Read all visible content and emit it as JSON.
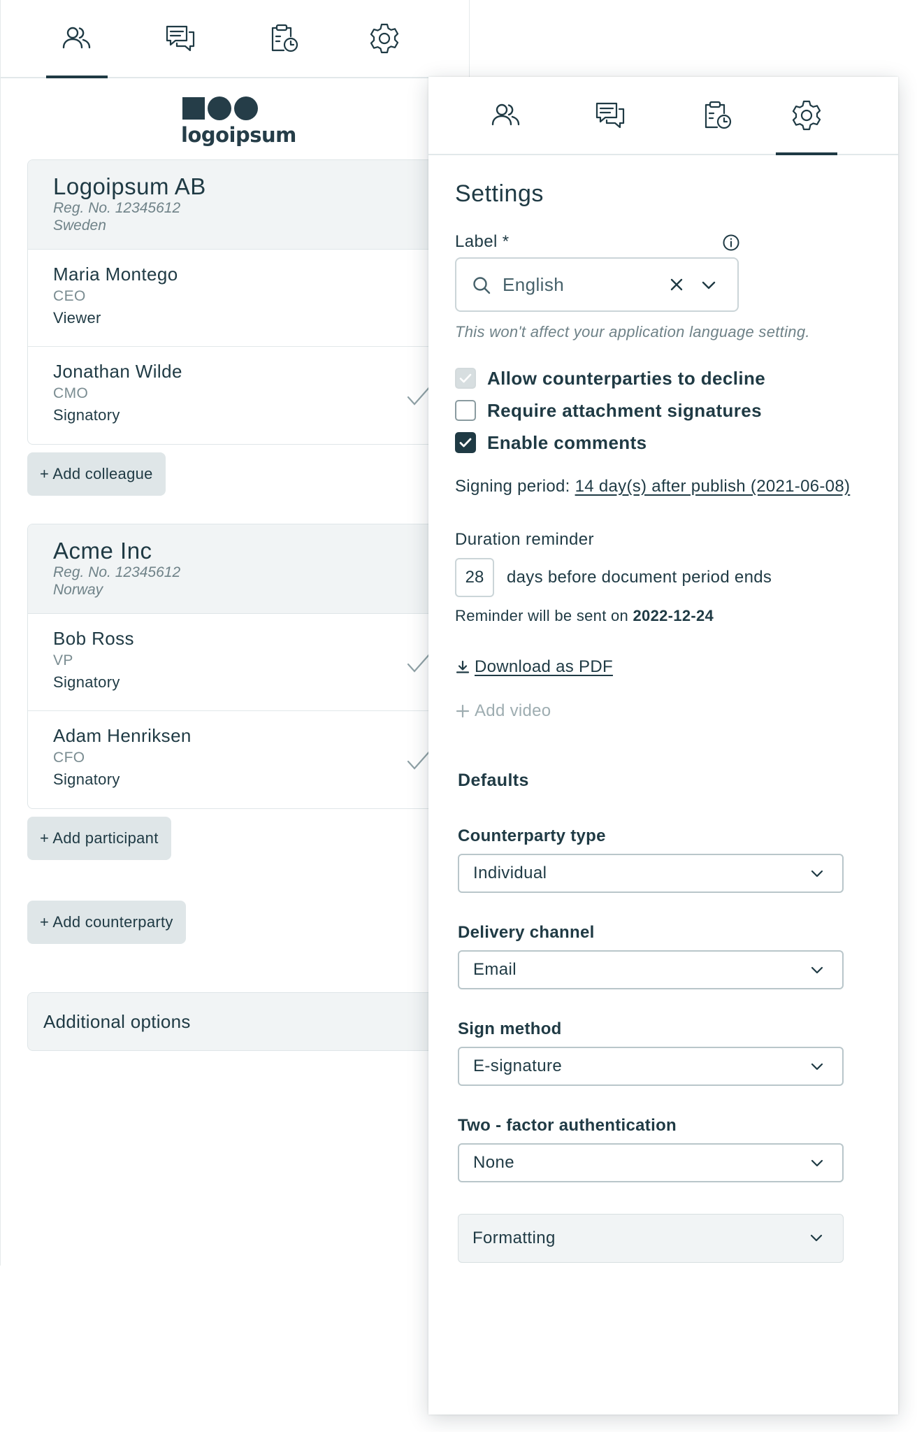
{
  "back_panel": {
    "tabs": [
      {
        "icon": "users-icon"
      },
      {
        "icon": "chat-icon"
      },
      {
        "icon": "clipboard-clock-icon"
      },
      {
        "icon": "gear-icon"
      }
    ],
    "active_tab": 0,
    "logo_text": "logoipsum",
    "companies": [
      {
        "name": "Logoipsum AB",
        "reg": "Reg. No. 12345612",
        "country": "Sweden",
        "people": [
          {
            "name": "Maria Montego",
            "title": "CEO",
            "role": "Viewer",
            "checked": false
          },
          {
            "name": "Jonathan Wilde",
            "title": "CMO",
            "role": "Signatory",
            "checked": true
          }
        ],
        "add_button": "+ Add colleague"
      },
      {
        "name": "Acme Inc",
        "reg": "Reg. No. 12345612",
        "country": "Norway",
        "people": [
          {
            "name": "Bob Ross",
            "title": "VP",
            "role": "Signatory",
            "checked": true
          },
          {
            "name": "Adam Henriksen",
            "title": "CFO",
            "role": "Signatory",
            "checked": true
          }
        ],
        "add_button": "+ Add participant"
      }
    ],
    "add_counterparty": "+ Add counterparty",
    "additional_options": "Additional options"
  },
  "settings": {
    "active_tab": 3,
    "title": "Settings",
    "label_field": {
      "label": "Label *",
      "value": "English",
      "hint": "This won't affect your application language setting."
    },
    "checkboxes": [
      {
        "label": "Allow counterparties to decline",
        "state": "disabled-checked"
      },
      {
        "label": "Require attachment signatures",
        "state": "unchecked"
      },
      {
        "label": "Enable comments",
        "state": "checked"
      }
    ],
    "signing_period_label": "Signing period:",
    "signing_period_value": "14 day(s) after publish (2021-06-08)",
    "duration_reminder": {
      "label": "Duration reminder",
      "days": "28",
      "suffix": "days before document period ends",
      "sent_prefix": "Reminder will be sent on",
      "sent_date": "2022-12-24"
    },
    "download_pdf": "Download as PDF",
    "add_video": "Add video",
    "defaults": {
      "title": "Defaults",
      "counterparty_type": {
        "label": "Counterparty type",
        "value": "Individual"
      },
      "delivery_channel": {
        "label": "Delivery channel",
        "value": "Email"
      },
      "sign_method": {
        "label": "Sign method",
        "value": "E-signature"
      },
      "two_factor": {
        "label": "Two - factor authentication",
        "value": "None"
      },
      "formatting": "Formatting"
    }
  },
  "colors": {
    "text": "#1f3a44",
    "muted": "#6f8288",
    "surface": "#f1f4f5",
    "button": "#dfe6e8"
  }
}
